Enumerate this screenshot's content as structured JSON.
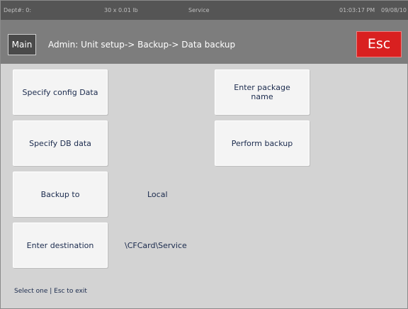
{
  "status_bar": {
    "dept": "Dept#: 0:",
    "scale": "30 x 0.01 lb",
    "mode": "Service",
    "time": "01:03:17 PM",
    "date": "09/08/10"
  },
  "title_bar": {
    "main_label": "Main",
    "breadcrumb": "Admin: Unit setup-> Backup-> Data backup",
    "esc_label": "Esc"
  },
  "buttons": {
    "specify_config": "Specify config Data",
    "specify_db": "Specify DB data",
    "backup_to": "Backup to",
    "enter_destination": "Enter destination",
    "enter_package": "Enter package name",
    "perform_backup": "Perform backup"
  },
  "values": {
    "backup_to": "Local",
    "destination": "\\CFCard\\Service"
  },
  "footer": "Select one | Esc to exit",
  "colors": {
    "background": "#d3d3d3",
    "status_bar": "#555555",
    "title_bar": "#7d7d7d",
    "esc_button": "#d92020",
    "button_text": "#1a2a4d"
  }
}
